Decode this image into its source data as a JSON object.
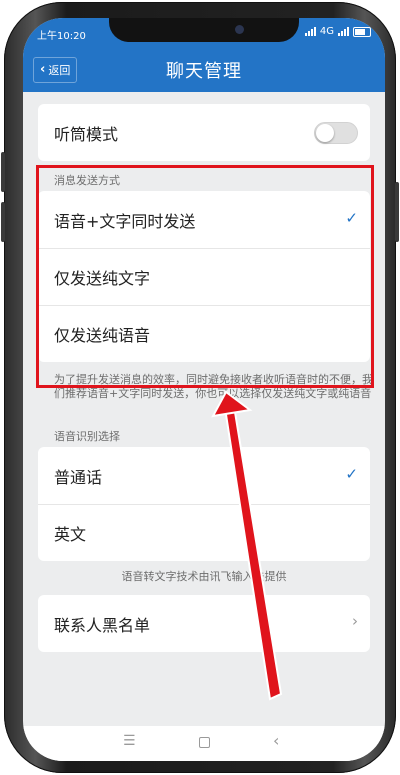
{
  "status_bar": {
    "time": "上午10:20",
    "network": "4G"
  },
  "nav": {
    "back_label": "返回",
    "title": "聊天管理"
  },
  "earpiece_mode": {
    "label": "听筒模式",
    "enabled": false
  },
  "send_method": {
    "section_label": "消息发送方式",
    "options": [
      {
        "label": "语音+文字同时发送",
        "selected": true
      },
      {
        "label": "仅发送纯文字",
        "selected": false
      },
      {
        "label": "仅发送纯语音",
        "selected": false
      }
    ],
    "note": "为了提升发送消息的效率，同时避免接收者收听语音时的不便，我们推荐语音+文字同时发送，你也可以选择仅发送纯文字或纯语音"
  },
  "speech_recognition": {
    "section_label": "语音识别选择",
    "options": [
      {
        "label": "普通话",
        "selected": true
      },
      {
        "label": "英文",
        "selected": false
      }
    ],
    "credit": "语音转文字技术由讯飞输入法提供"
  },
  "blacklist": {
    "label": "联系人黑名单"
  },
  "colors": {
    "accent": "#2374c6",
    "highlight": "#e0141c",
    "background": "#ecedee"
  },
  "icons": {
    "back": "chevron-left-icon",
    "selected": "checkmark-icon",
    "more": "chevron-right-icon"
  }
}
